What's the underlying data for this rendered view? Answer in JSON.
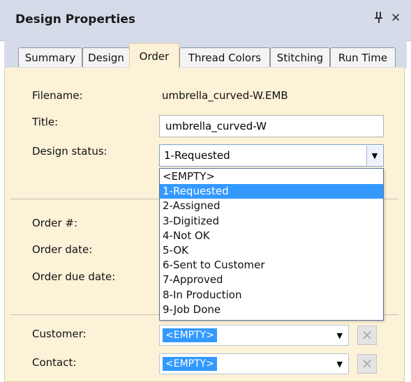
{
  "panel": {
    "title": "Design Properties",
    "pin_icon": "pin-icon",
    "close_icon": "close-icon"
  },
  "tabs": [
    {
      "label": "Summary"
    },
    {
      "label": "Design"
    },
    {
      "label": "Order"
    },
    {
      "label": "Thread Colors"
    },
    {
      "label": "Stitching"
    },
    {
      "label": "Run Time"
    }
  ],
  "active_tab": "Order",
  "fields": {
    "filename_label": "Filename:",
    "filename_value": "umbrella_curved-W.EMB",
    "title_label": "Title:",
    "title_value": "umbrella_curved-W",
    "status_label": "Design status:",
    "status_value": "1-Requested",
    "order_num_label": "Order #:",
    "order_date_label": "Order date:",
    "order_due_label": "Order due date:",
    "customer_label": "Customer:",
    "customer_value": "<EMPTY>",
    "contact_label": "Contact:",
    "contact_value": "<EMPTY>"
  },
  "status_options": [
    "<EMPTY>",
    "1-Requested",
    "2-Assigned",
    "3-Digitized",
    "4-Not OK",
    "5-OK",
    "6-Sent to Customer",
    "7-Approved",
    "8-In Production",
    "9-Job Done"
  ],
  "status_selected_index": 1,
  "colors": {
    "header_bg": "#d6dbe9",
    "body_bg": "#fcf2d8",
    "selection": "#3399ff"
  }
}
